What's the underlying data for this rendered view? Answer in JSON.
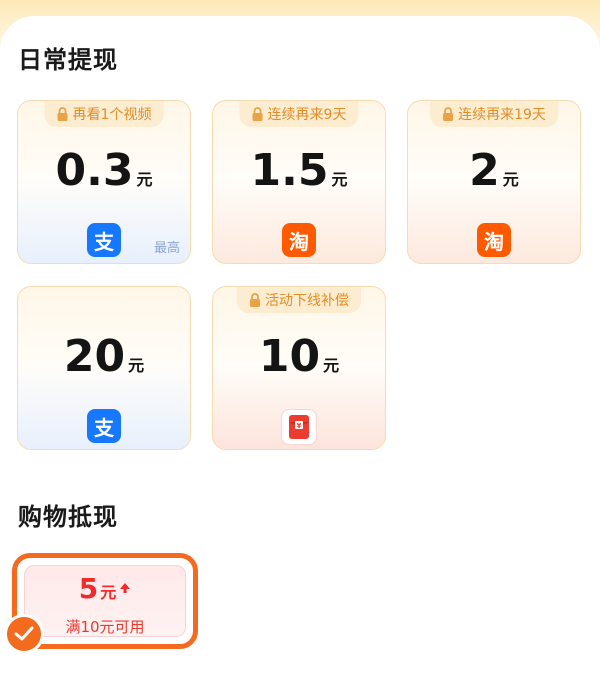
{
  "daily": {
    "title": "日常提现",
    "cards": [
      {
        "tag": "再看1个视频",
        "amount": "0.3",
        "unit": "元",
        "pay": "alipay",
        "pay_glyph": "支",
        "note": "最高"
      },
      {
        "tag": "连续再来9天",
        "amount": "1.5",
        "unit": "元",
        "pay": "taobao",
        "pay_glyph": "淘"
      },
      {
        "tag": "连续再来19天",
        "amount": "2",
        "unit": "元",
        "pay": "taobao",
        "pay_glyph": "淘"
      },
      {
        "amount": "20",
        "unit": "元",
        "pay": "alipay",
        "pay_glyph": "支"
      },
      {
        "tag": "活动下线补偿",
        "amount": "10",
        "unit": "元",
        "pay": "red-packet",
        "pay_glyph": "¥"
      }
    ]
  },
  "shopping": {
    "title": "购物抵现",
    "coupon": {
      "amount": "5",
      "unit": "元",
      "condition": "满10元可用",
      "selected": true
    }
  },
  "icons": {
    "lock": "lock-icon",
    "alipay": "alipay-icon",
    "taobao": "taobao-icon",
    "red_packet": "red-packet-icon",
    "arrow": "arrow-up-icon",
    "check": "check-icon"
  },
  "colors": {
    "alipay": "#1677ff",
    "taobao": "#ff5a00",
    "tag_text": "#e38d24",
    "coupon_accent": "#f46a1f",
    "coupon_text": "#f12b2b"
  }
}
